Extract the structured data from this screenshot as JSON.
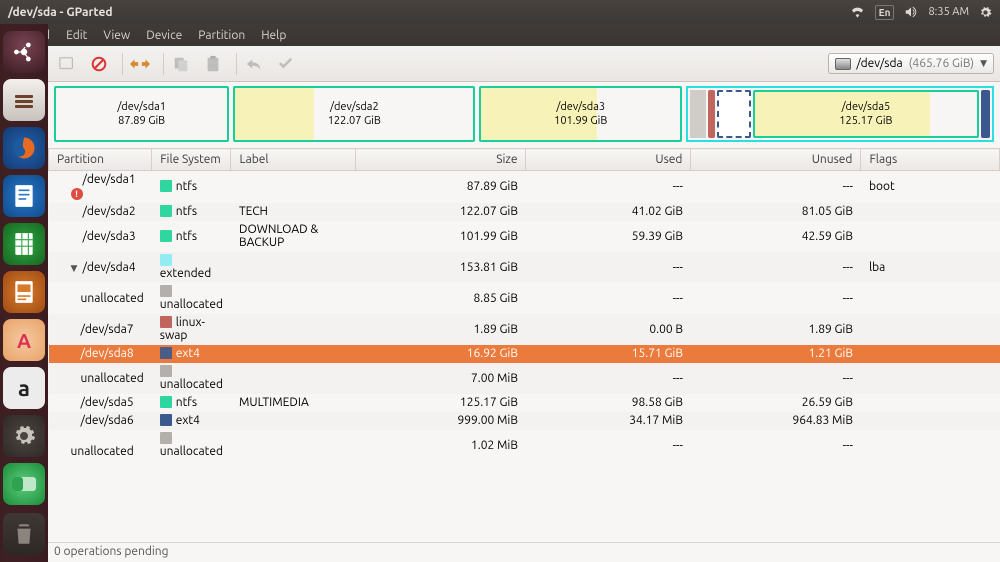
{
  "window": {
    "title": "/dev/sda - GParted"
  },
  "panel": {
    "time": "8:35 AM",
    "lang": "En"
  },
  "menubar": {
    "app": "GParted",
    "edit": "Edit",
    "view": "View",
    "device": "Device",
    "partition": "Partition",
    "help": "Help"
  },
  "device_select": {
    "path": "/dev/sda",
    "size": "(465.76 GiB)"
  },
  "part_blocks": [
    {
      "name": "/dev/sda1",
      "size": "87.89 GiB",
      "color": "#17cf98",
      "fill_pct": 0
    },
    {
      "name": "/dev/sda2",
      "size": "122.07 GiB",
      "color": "#17cf98",
      "fill_pct": 33
    },
    {
      "name": "/dev/sda3",
      "size": "101.99 GiB",
      "color": "#17cf98",
      "fill_pct": 58
    }
  ],
  "nested_block": {
    "name": "/dev/sda5",
    "size": "125.17 GiB",
    "color": "#17cf98",
    "fill_pct": 79
  },
  "table": {
    "headers": {
      "partition": "Partition",
      "fs": "File System",
      "label": "Label",
      "size": "Size",
      "used": "Used",
      "unused": "Unused",
      "flags": "Flags"
    },
    "rows": [
      {
        "part": "/dev/sda1",
        "warn": true,
        "fs": "ntfs",
        "fs_class": "fs-ntfs",
        "label": "",
        "size": "87.89 GiB",
        "used": "---",
        "unused": "---",
        "flags": "boot",
        "indent": 1
      },
      {
        "part": "/dev/sda2",
        "fs": "ntfs",
        "fs_class": "fs-ntfs",
        "label": "TECH",
        "size": "122.07 GiB",
        "used": "41.02 GiB",
        "unused": "81.05 GiB",
        "flags": "",
        "indent": 1
      },
      {
        "part": "/dev/sda3",
        "fs": "ntfs",
        "fs_class": "fs-ntfs",
        "label": "DOWNLOAD & BACKUP",
        "size": "101.99 GiB",
        "used": "59.39 GiB",
        "unused": "42.59 GiB",
        "flags": "",
        "indent": 1
      },
      {
        "part": "/dev/sda4",
        "arrow": true,
        "fs": "extended",
        "fs_class": "fs-extended",
        "label": "",
        "size": "153.81 GiB",
        "used": "---",
        "unused": "---",
        "flags": "lba",
        "indent": 1
      },
      {
        "part": "unallocated",
        "fs": "unallocated",
        "fs_class": "fs-unalloc",
        "label": "",
        "size": "8.85 GiB",
        "used": "---",
        "unused": "---",
        "flags": "",
        "indent": 2
      },
      {
        "part": "/dev/sda7",
        "fs": "linux-swap",
        "fs_class": "fs-swap",
        "label": "",
        "size": "1.89 GiB",
        "used": "0.00 B",
        "unused": "1.89 GiB",
        "flags": "",
        "indent": 2
      },
      {
        "part": "/dev/sda8",
        "fs": "ext4",
        "fs_class": "fs-ext4",
        "label": "",
        "size": "16.92 GiB",
        "used": "15.71 GiB",
        "unused": "1.21 GiB",
        "flags": "",
        "indent": 2,
        "selected": true
      },
      {
        "part": "unallocated",
        "fs": "unallocated",
        "fs_class": "fs-unalloc",
        "label": "",
        "size": "7.00 MiB",
        "used": "---",
        "unused": "---",
        "flags": "",
        "indent": 2
      },
      {
        "part": "/dev/sda5",
        "fs": "ntfs",
        "fs_class": "fs-ntfs",
        "label": "MULTIMEDIA",
        "size": "125.17 GiB",
        "used": "98.58 GiB",
        "unused": "26.59 GiB",
        "flags": "",
        "indent": 2
      },
      {
        "part": "/dev/sda6",
        "fs": "ext4",
        "fs_class": "fs-ext4",
        "label": "",
        "size": "999.00 MiB",
        "used": "34.17 MiB",
        "unused": "964.83 MiB",
        "flags": "",
        "indent": 2
      },
      {
        "part": "unallocated",
        "fs": "unallocated",
        "fs_class": "fs-unalloc",
        "label": "",
        "size": "1.02 MiB",
        "used": "---",
        "unused": "---",
        "flags": "",
        "indent": 1
      }
    ]
  },
  "status": {
    "pending": "0 operations pending"
  }
}
